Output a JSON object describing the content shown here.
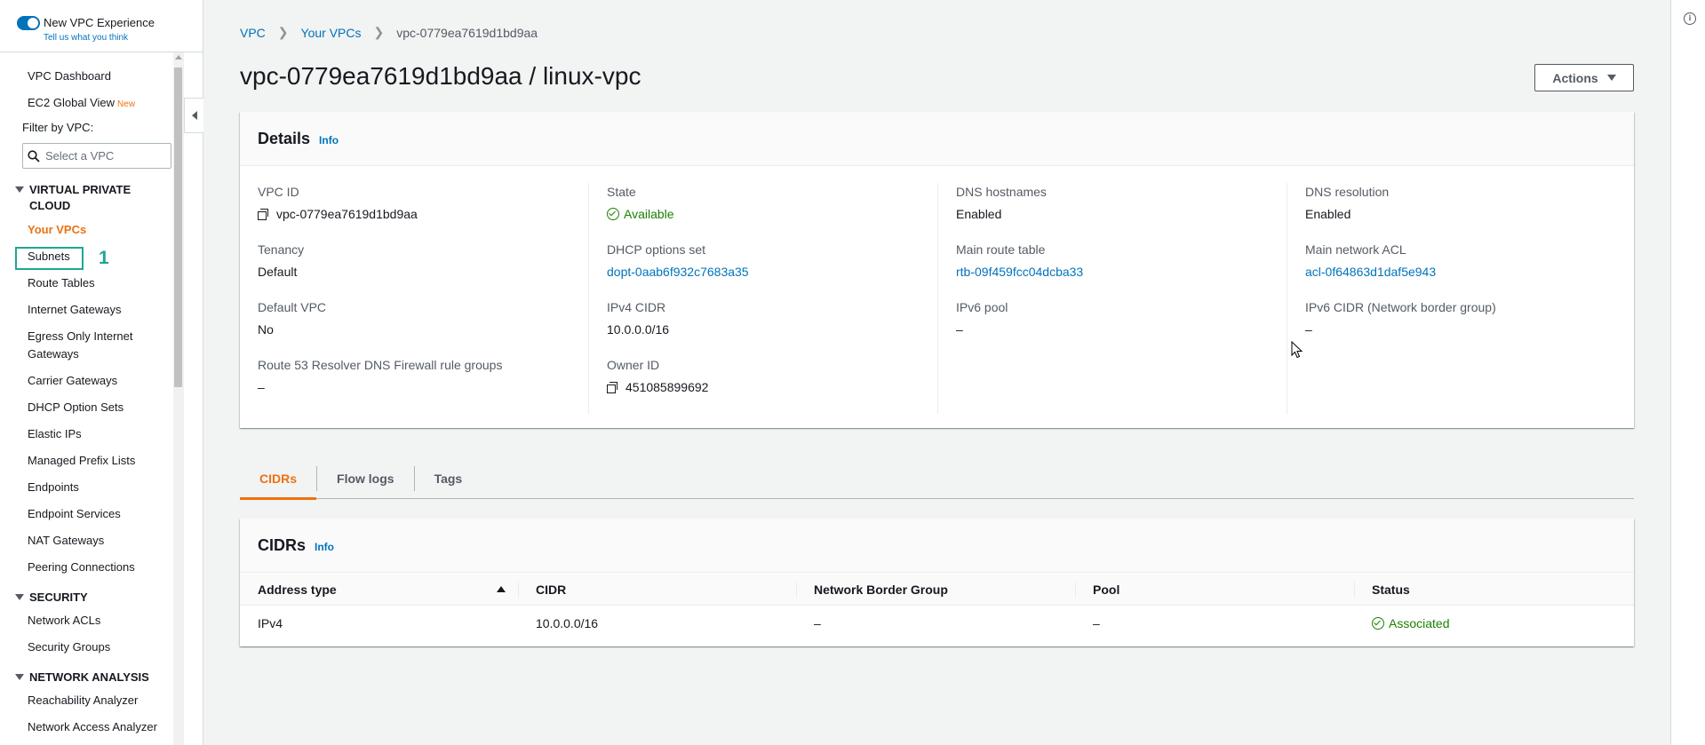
{
  "sidebar": {
    "toggle_label": "New VPC Experience",
    "toggle_sub": "Tell us what you think",
    "dashboard": "VPC Dashboard",
    "ec2_global": "EC2 Global View",
    "new_badge": "New",
    "filter_label": "Filter by VPC:",
    "filter_placeholder": "Select a VPC",
    "section_vpc": "VIRTUAL PRIVATE CLOUD",
    "items_vpc": [
      "Your VPCs",
      "Subnets",
      "Route Tables",
      "Internet Gateways",
      "Egress Only Internet Gateways",
      "Carrier Gateways",
      "DHCP Option Sets",
      "Elastic IPs",
      "Managed Prefix Lists",
      "Endpoints",
      "Endpoint Services",
      "NAT Gateways",
      "Peering Connections"
    ],
    "section_security": "SECURITY",
    "items_security": [
      "Network ACLs",
      "Security Groups"
    ],
    "section_network": "NETWORK ANALYSIS",
    "items_network": [
      "Reachability Analyzer",
      "Network Access Analyzer"
    ],
    "annotation_number": "1"
  },
  "breadcrumb": [
    "VPC",
    "Your VPCs",
    "vpc-0779ea7619d1bd9aa"
  ],
  "page_title": "vpc-0779ea7619d1bd9aa / linux-vpc",
  "actions_label": "Actions",
  "details": {
    "title": "Details",
    "info": "Info",
    "col1": [
      {
        "k": "VPC ID",
        "v": "vpc-0779ea7619d1bd9aa"
      },
      {
        "k": "Tenancy",
        "v": "Default"
      },
      {
        "k": "Default VPC",
        "v": "No"
      },
      {
        "k": "Route 53 Resolver DNS Firewall rule groups",
        "v": "–"
      }
    ],
    "col2": [
      {
        "k": "State",
        "v": "Available"
      },
      {
        "k": "DHCP options set",
        "v": "dopt-0aab6f932c7683a35"
      },
      {
        "k": "IPv4 CIDR",
        "v": "10.0.0.0/16"
      },
      {
        "k": "Owner ID",
        "v": "451085899692"
      }
    ],
    "col3": [
      {
        "k": "DNS hostnames",
        "v": "Enabled"
      },
      {
        "k": "Main route table",
        "v": "rtb-09f459fcc04dcba33"
      },
      {
        "k": "IPv6 pool",
        "v": "–"
      }
    ],
    "col4": [
      {
        "k": "DNS resolution",
        "v": "Enabled"
      },
      {
        "k": "Main network ACL",
        "v": "acl-0f64863d1daf5e943"
      },
      {
        "k": "IPv6 CIDR (Network border group)",
        "v": "–"
      }
    ]
  },
  "tabs": [
    "CIDRs",
    "Flow logs",
    "Tags"
  ],
  "cidrs": {
    "title": "CIDRs",
    "info": "Info",
    "columns": [
      "Address type",
      "CIDR",
      "Network Border Group",
      "Pool",
      "Status"
    ],
    "rows": [
      [
        "IPv4",
        "10.0.0.0/16",
        "–",
        "–",
        "Associated"
      ]
    ]
  },
  "colors": {
    "accent": "#ec7211",
    "link": "#0073bb",
    "success": "#1d8102",
    "annotation": "#1fa693"
  }
}
